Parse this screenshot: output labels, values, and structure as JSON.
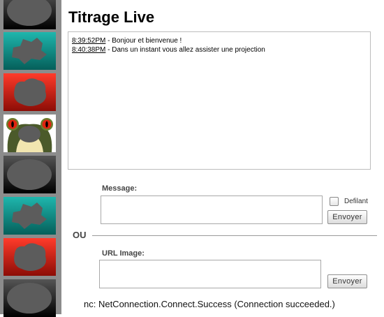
{
  "title": "Titrage Live",
  "log": [
    {
      "time": "8:39:52PM",
      "text": " - Bonjour et bienvenue !"
    },
    {
      "time": "8:40:38PM",
      "text": " - Dans un instant vous allez assister une projection"
    }
  ],
  "message": {
    "label": "Message:",
    "value": ""
  },
  "defilant": {
    "label": "Defilant",
    "checked": false
  },
  "send_label": "Envoyer",
  "separator": "OU",
  "url_image": {
    "label": "URL Image:",
    "value": ""
  },
  "status": "nc: NetConnection.Connect.Success (Connection succeeded.)",
  "thumbnails": [
    {
      "icon": "image-placeholder-dark",
      "bg": "#000000"
    },
    {
      "icon": "image-placeholder-teal",
      "bg": "#0aa39a"
    },
    {
      "icon": "image-placeholder-red",
      "bg": "#e0241a"
    },
    {
      "icon": "frog-image",
      "bg": "#ffffff"
    },
    {
      "icon": "image-placeholder-dark",
      "bg": "#000000"
    },
    {
      "icon": "image-placeholder-teal",
      "bg": "#0aa39a"
    },
    {
      "icon": "image-placeholder-red",
      "bg": "#e0241a"
    },
    {
      "icon": "image-placeholder-dark",
      "bg": "#000000"
    }
  ]
}
